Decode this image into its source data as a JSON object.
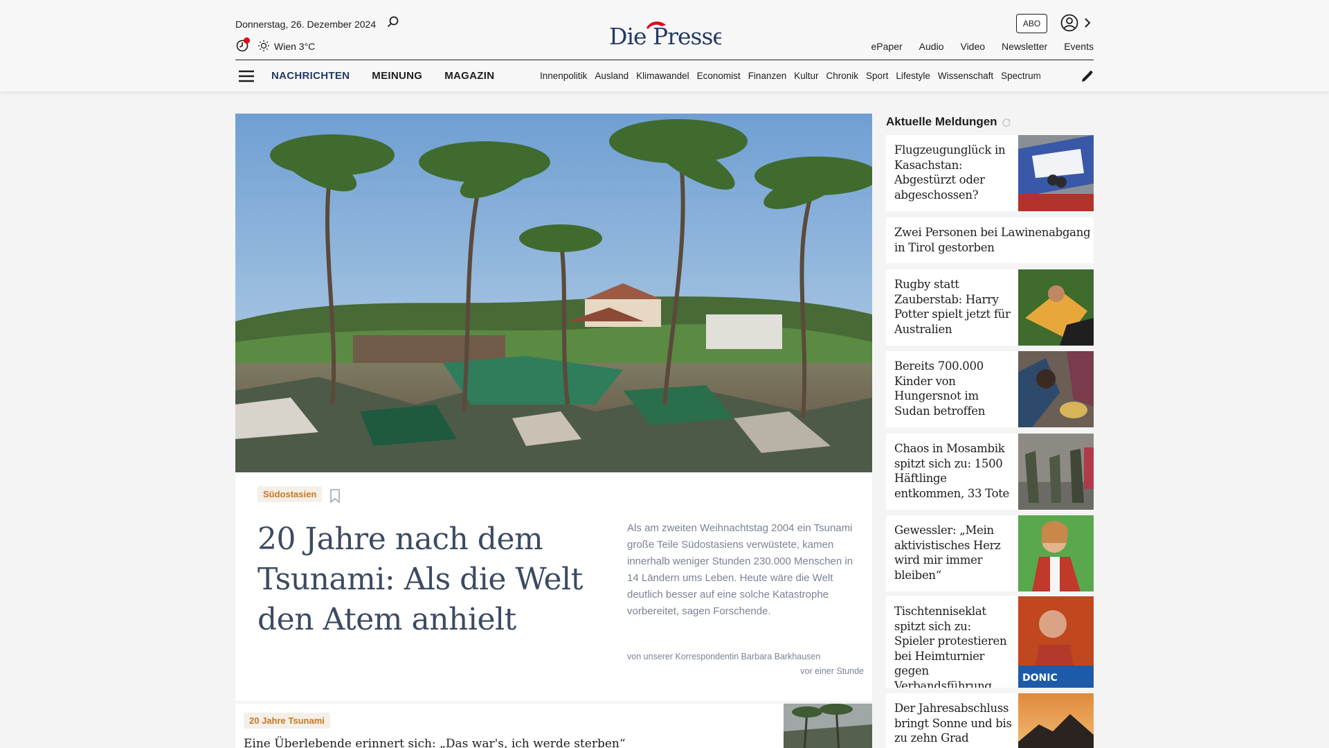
{
  "header": {
    "date": "Donnerstag, 26. Dezember 2024",
    "weather": "Wien 3°C",
    "logo_text": "Die Presse",
    "abo_label": "ABO",
    "top_links": [
      "ePaper",
      "Audio",
      "Video",
      "Newsletter",
      "Events"
    ],
    "main_nav": [
      "NACHRICHTEN",
      "MEINUNG",
      "MAGAZIN"
    ],
    "sub_nav": [
      "Innenpolitik",
      "Ausland",
      "Klimawandel",
      "Economist",
      "Finanzen",
      "Kultur",
      "Chronik",
      "Sport",
      "Lifestyle",
      "Wissenschaft",
      "Spectrum"
    ],
    "accent_color": "#243b66",
    "brand_red": "#e2001a"
  },
  "hero": {
    "tag": "Südostasien",
    "title": "20 Jahre nach dem Tsunami: Als die Welt den Atem anhielt",
    "teaser": "Als am zweiten Weihnachtstag 2004 ein Tsunami große Teile Südostasiens verwüstete, kamen innerhalb weniger Stunden 230.000 Menschen in 14 Ländern ums Leben. Heute wäre die Welt deutlich besser auf eine solche Katastrophe vorbereitet, sagen Forschende.",
    "author": "von unserer Korrespondentin Barbara Barkhausen",
    "time": "vor einer Stunde"
  },
  "second": {
    "tag": "20 Jahre Tsunami",
    "title": "Eine Überlebende erinnert sich: „Das war's, ich werde sterben“"
  },
  "sidebar": {
    "heading": "Aktuelle Meldungen",
    "items": [
      {
        "title": "Flugzeugunglück in Kasachstan: Abgestürzt oder abgeschossen?"
      },
      {
        "title": "Zwei Personen bei Lawinenabgang in Tirol gestorben"
      },
      {
        "title": "Rugby statt Zauberstab: Harry Potter spielt jetzt für Australien"
      },
      {
        "title": "Bereits 700.000 Kinder von Hungersnot im Sudan betroffen"
      },
      {
        "title": "Chaos in Mosambik spitzt sich zu: 1500 Häftlinge entkommen, 33 Tote"
      },
      {
        "title": "Gewessler: „Mein aktivistisches Herz wird mir immer bleiben“"
      },
      {
        "title": "Tischtennisekl at spitzt sich zu: Spieler protestieren bei Heimturnier gegen Verbandsführung"
      },
      {
        "title": "Der Jahresabschluss bringt Sonne und bis zu zehn Grad"
      }
    ]
  }
}
